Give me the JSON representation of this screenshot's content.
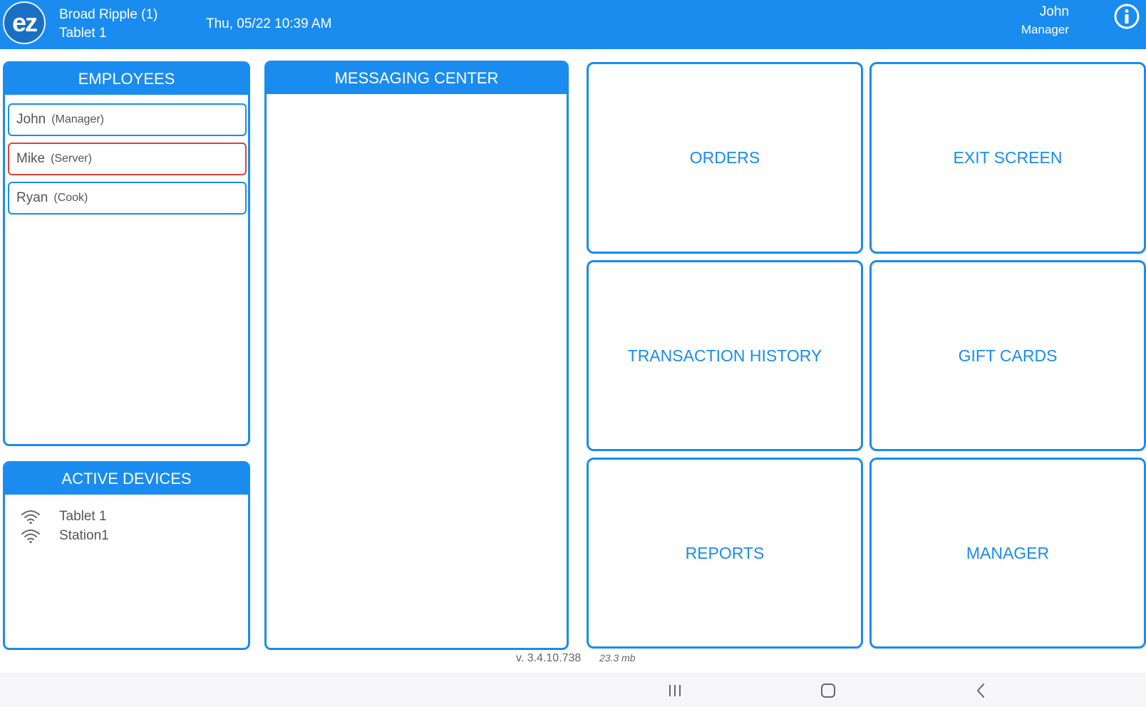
{
  "header": {
    "logo_text": "ez",
    "location": "Broad Ripple (1)",
    "device": "Tablet 1",
    "datetime": "Thu, 05/22 10:39 AM",
    "user_name": "John",
    "user_role": "Manager"
  },
  "employees": {
    "title": "EMPLOYEES",
    "items": [
      {
        "name": "John",
        "role": "(Manager)"
      },
      {
        "name": "Mike",
        "role": "(Server)"
      },
      {
        "name": "Ryan",
        "role": "(Cook)"
      }
    ]
  },
  "active_devices": {
    "title": "ACTIVE DEVICES",
    "items": [
      {
        "name": "Tablet 1"
      },
      {
        "name": "Station1"
      }
    ]
  },
  "messaging": {
    "title": "MESSAGING CENTER"
  },
  "tiles": {
    "orders": "ORDERS",
    "exit_screen": "EXIT SCREEN",
    "transaction_history": "TRANSACTION HISTORY",
    "gift_cards": "GIFT CARDS",
    "reports": "REPORTS",
    "manager": "MANAGER"
  },
  "footer": {
    "version": "v. 3.4.10.738",
    "memory": "23.3  mb"
  },
  "colors": {
    "accent": "#1a8cf0",
    "selected_border": "#d9433a"
  }
}
